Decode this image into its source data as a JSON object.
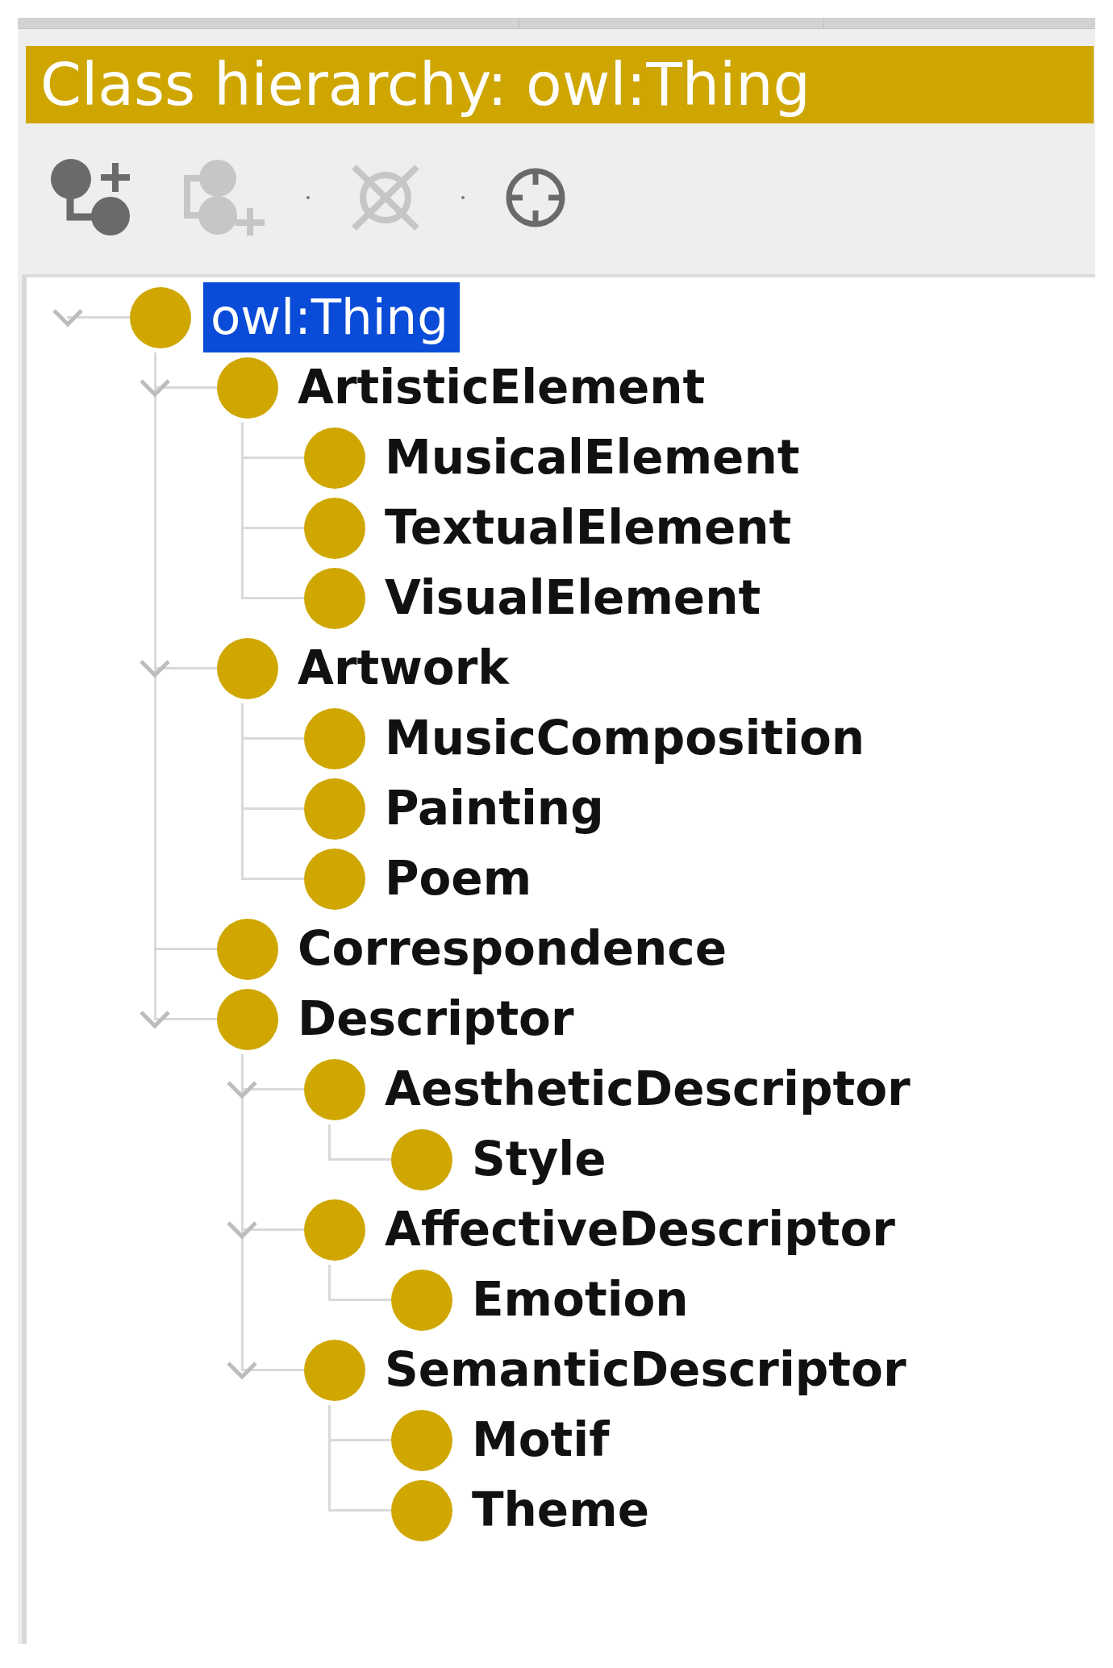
{
  "panel": {
    "title": "Class hierarchy: owl:Thing"
  },
  "toolbar": {
    "groups": [
      {
        "buttons": [
          {
            "kind": "subclass",
            "disabled": false
          },
          {
            "kind": "sibling",
            "disabled": true
          }
        ]
      },
      {
        "buttons": [
          {
            "kind": "delete",
            "disabled": true
          }
        ]
      },
      {
        "buttons": [
          {
            "kind": "locate",
            "disabled": false
          }
        ]
      }
    ]
  },
  "tree": [
    {
      "label": "owl:Thing",
      "kind": "builtin",
      "selected": true,
      "expanded": true,
      "children": [
        {
          "label": "ArtisticElement",
          "kind": "class",
          "selected": false,
          "expanded": true,
          "children": [
            {
              "label": "MusicalElement",
              "kind": "class",
              "selected": false
            },
            {
              "label": "TextualElement",
              "kind": "class",
              "selected": false
            },
            {
              "label": "VisualElement",
              "kind": "class",
              "selected": false
            }
          ]
        },
        {
          "label": "Artwork",
          "kind": "class",
          "selected": false,
          "expanded": true,
          "children": [
            {
              "label": "MusicComposition",
              "kind": "class",
              "selected": false
            },
            {
              "label": "Painting",
              "kind": "class",
              "selected": false
            },
            {
              "label": "Poem",
              "kind": "class",
              "selected": false
            }
          ]
        },
        {
          "label": "Correspondence",
          "kind": "class",
          "selected": false
        },
        {
          "label": "Descriptor",
          "kind": "class",
          "selected": false,
          "expanded": true,
          "children": [
            {
              "label": "AestheticDescriptor",
              "kind": "class",
              "selected": false,
              "expanded": true,
              "children": [
                {
                  "label": "Style",
                  "kind": "class",
                  "selected": false
                }
              ]
            },
            {
              "label": "AffectiveDescriptor",
              "kind": "class",
              "selected": false,
              "expanded": true,
              "children": [
                {
                  "label": "Emotion",
                  "kind": "class",
                  "selected": false
                }
              ]
            },
            {
              "label": "SemanticDescriptor",
              "kind": "class",
              "selected": false,
              "expanded": true,
              "children": [
                {
                  "label": "Motif",
                  "kind": "class",
                  "selected": false
                },
                {
                  "label": "Theme",
                  "kind": "class",
                  "selected": false
                }
              ]
            }
          ]
        }
      ]
    }
  ]
}
